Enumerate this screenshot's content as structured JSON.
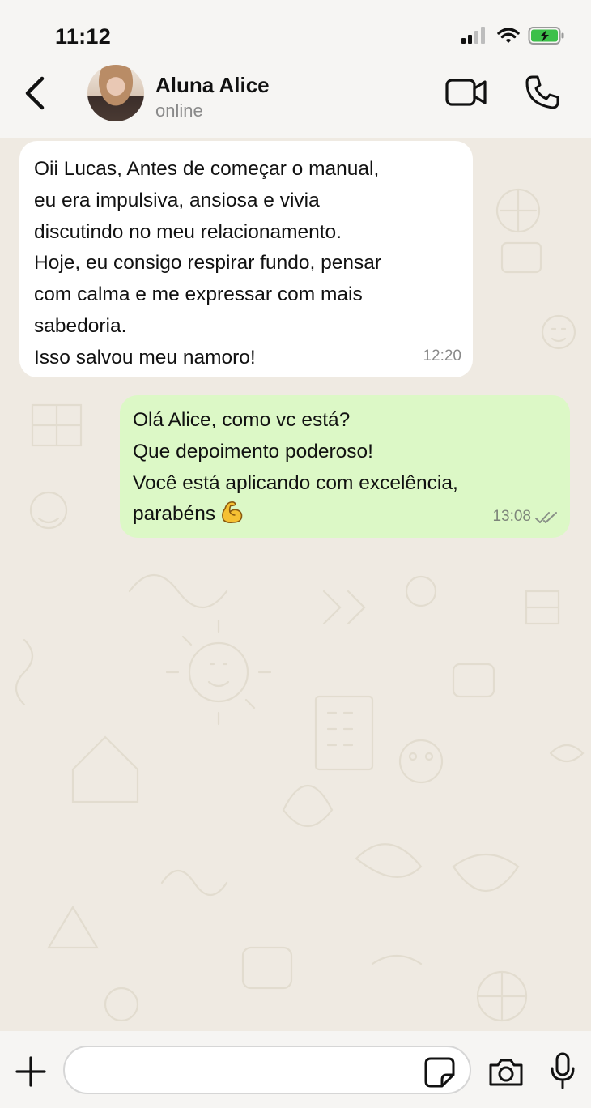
{
  "status_bar": {
    "time": "11:12",
    "icons": [
      "signal-icon",
      "wifi-icon",
      "battery-charging-icon"
    ]
  },
  "header": {
    "contact_name": "Aluna Alice",
    "contact_status": "online",
    "icons": [
      "back-chevron-icon",
      "video-call-icon",
      "phone-call-icon"
    ]
  },
  "messages": [
    {
      "direction": "incoming",
      "lines": [
        "Oii Lucas, Antes de começar o manual,",
        "eu era impulsiva, ansiosa e vivia",
        "discutindo no meu relacionamento.",
        "Hoje, eu consigo respirar fundo, pensar",
        "com calma e me expressar com mais",
        "sabedoria.",
        "Isso salvou meu namoro!"
      ],
      "time": "12:20"
    },
    {
      "direction": "outgoing",
      "lines": [
        "Olá Alice, como vc está?",
        "Que depoimento poderoso!",
        "Você está aplicando com excelência,",
        "parabéns"
      ],
      "emoji": "flexed-biceps",
      "time": "13:08",
      "read_status": "double-check-read"
    }
  ],
  "composer": {
    "placeholder": "",
    "icons": [
      "plus-icon",
      "sticker-icon",
      "camera-icon",
      "microphone-icon"
    ]
  },
  "colors": {
    "incoming_bubble": "#ffffff",
    "outgoing_bubble": "#dcf8c6",
    "chat_background": "#efeae2",
    "bar_background": "#f6f5f3"
  }
}
